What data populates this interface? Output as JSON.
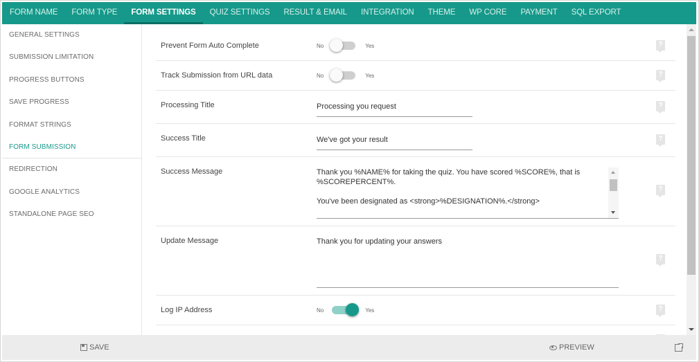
{
  "tabs": [
    {
      "label": "FORM NAME"
    },
    {
      "label": "FORM TYPE"
    },
    {
      "label": "FORM SETTINGS"
    },
    {
      "label": "QUIZ SETTINGS"
    },
    {
      "label": "RESULT & EMAIL"
    },
    {
      "label": "INTEGRATION"
    },
    {
      "label": "THEME"
    },
    {
      "label": "WP CORE"
    },
    {
      "label": "PAYMENT"
    },
    {
      "label": "SQL EXPORT"
    }
  ],
  "active_tab": "FORM SETTINGS",
  "sidebar": {
    "items": [
      {
        "label": "GENERAL SETTINGS"
      },
      {
        "label": "SUBMISSION LIMITATION"
      },
      {
        "label": "PROGRESS BUTTONS"
      },
      {
        "label": "SAVE PROGRESS"
      },
      {
        "label": "FORMAT STRINGS"
      },
      {
        "label": "FORM SUBMISSION"
      },
      {
        "label": "REDIRECTION"
      },
      {
        "label": "GOOGLE ANALYTICS"
      },
      {
        "label": "STANDALONE PAGE SEO"
      }
    ],
    "active": "FORM SUBMISSION"
  },
  "settings": {
    "auto_complete": {
      "label": "Prevent Form Auto Complete",
      "no": "No",
      "yes": "Yes",
      "checked": false
    },
    "track_url": {
      "label": "Track Submission from URL data",
      "no": "No",
      "yes": "Yes",
      "checked": false
    },
    "processing_title": {
      "label": "Processing Title",
      "value": "Processing you request"
    },
    "success_title": {
      "label": "Success Title",
      "value": "We've got your result"
    },
    "success_message": {
      "label": "Success Message",
      "line1": "Thank you %NAME% for taking the quiz. You have scored %SCORE%, that is %SCOREPERCENT%.",
      "line2": "You've been designated as <strong>%DESIGNATION%.</strong>"
    },
    "update_message": {
      "label": "Update Message",
      "value": "Thank you for updating your answers"
    },
    "log_ip": {
      "label": "Log IP Address",
      "no": "No",
      "yes": "Yes",
      "checked": true
    }
  },
  "help_glyph": "?",
  "footer": {
    "save_label": "SAVE",
    "preview_label": "PREVIEW"
  },
  "colors": {
    "accent": "#16998a",
    "topbar": "#16998a",
    "footer": "#ececec"
  },
  "icons": {
    "save": "floppy-disk-icon",
    "preview": "eye-icon",
    "external": "external-link-icon",
    "help": "help-icon"
  }
}
